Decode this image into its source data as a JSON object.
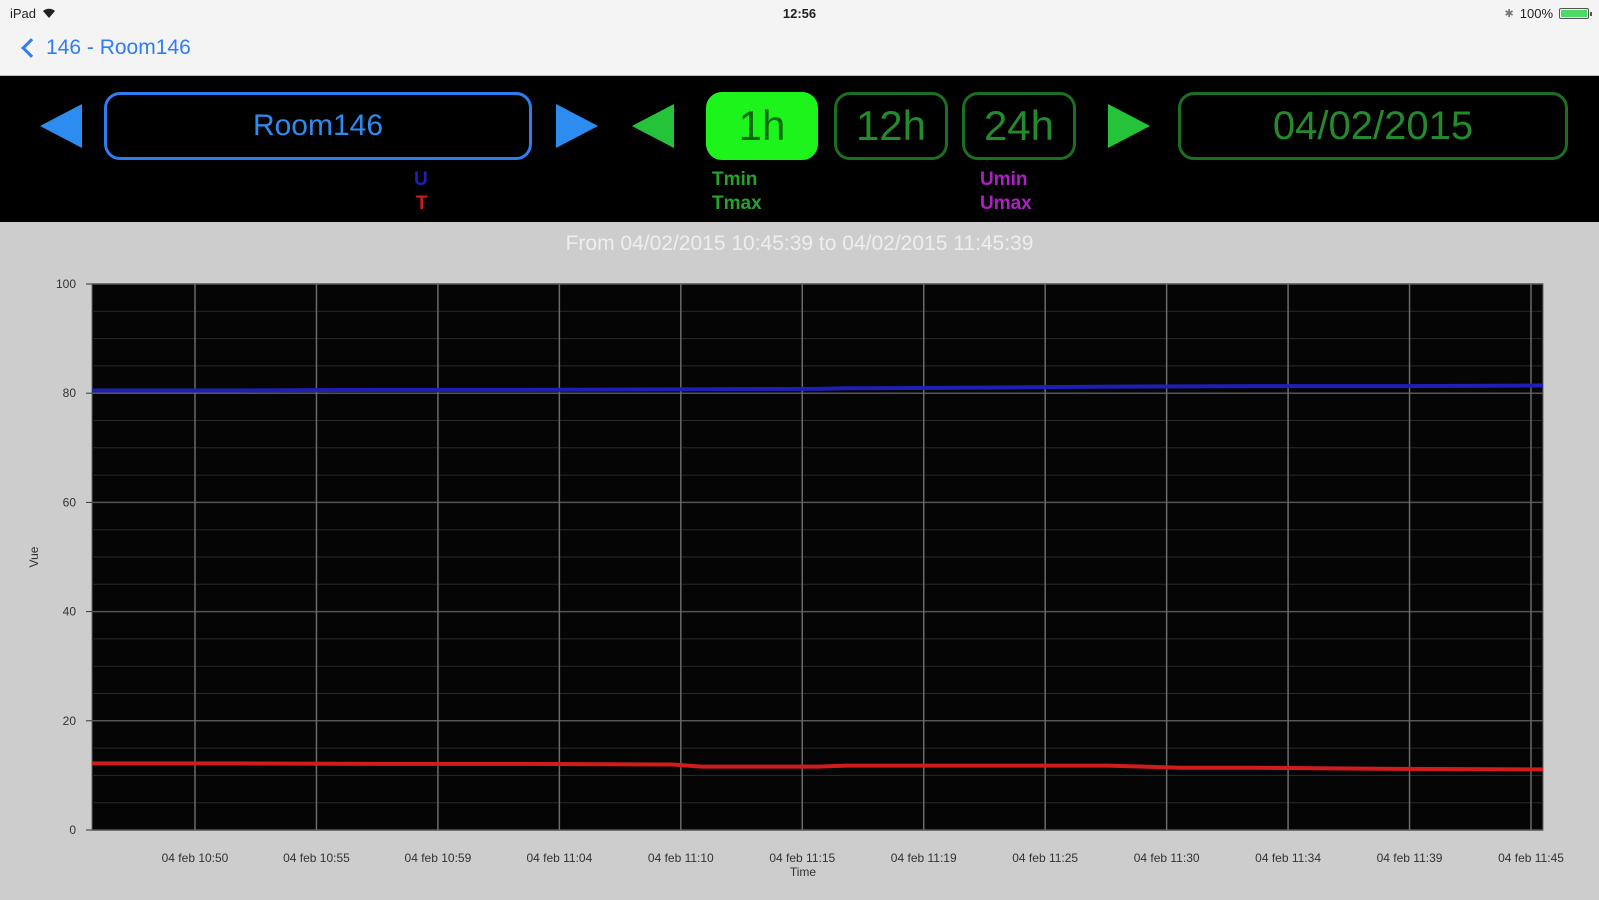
{
  "status_bar": {
    "carrier": "iPad",
    "time": "12:56",
    "battery": "100%",
    "battery_level": 1.0
  },
  "nav": {
    "back_label": "146 - Room146"
  },
  "controls": {
    "room": "Room146",
    "ranges": [
      "1h",
      "12h",
      "24h"
    ],
    "selected_range": "1h",
    "date": "04/02/2015",
    "legend": {
      "u": "U",
      "t": "T",
      "tmin": "Tmin",
      "tmax": "Tmax",
      "umin": "Umin",
      "umax": "Umax"
    },
    "colors": {
      "blue": "#2d8cf0",
      "green": "#25c33a",
      "active_green": "#1cf41c",
      "u": "#1f1fb5",
      "t": "#d21c1c",
      "tminmax": "#24a52a",
      "uminmax": "#b01ec6"
    }
  },
  "range_text": "From 04/02/2015 10:45:39 to 04/02/2015 11:45:39",
  "chart_data": {
    "type": "line",
    "xlabel": "Time",
    "ylabel": "Vue",
    "ylim": [
      0,
      100
    ],
    "yticks": [
      0,
      20,
      40,
      60,
      80,
      100
    ],
    "xtick_labels": [
      "04 feb 10:50",
      "04 feb 10:55",
      "04 feb 10:59",
      "04 feb 11:04",
      "04 feb 11:10",
      "04 feb 11:15",
      "04 feb 11:19",
      "04 feb 11:25",
      "04 feb 11:30",
      "04 feb 11:34",
      "04 feb 11:39",
      "04 feb 11:45"
    ],
    "grid": true,
    "series": [
      {
        "name": "U",
        "color": "#1f1fb5",
        "x": [
          0,
          10,
          20,
          30,
          40,
          50,
          52,
          60,
          70,
          80,
          90,
          100
        ],
        "values": [
          80.5,
          80.5,
          80.6,
          80.6,
          80.7,
          80.8,
          80.9,
          81.0,
          81.2,
          81.3,
          81.3,
          81.4
        ]
      },
      {
        "name": "T",
        "color": "#d21c1c",
        "x": [
          0,
          10,
          20,
          30,
          40,
          42,
          50,
          52,
          60,
          70,
          75,
          80,
          90,
          100
        ],
        "values": [
          12.2,
          12.2,
          12.1,
          12.1,
          12.0,
          11.6,
          11.6,
          11.8,
          11.8,
          11.8,
          11.4,
          11.4,
          11.2,
          11.1
        ]
      }
    ]
  }
}
